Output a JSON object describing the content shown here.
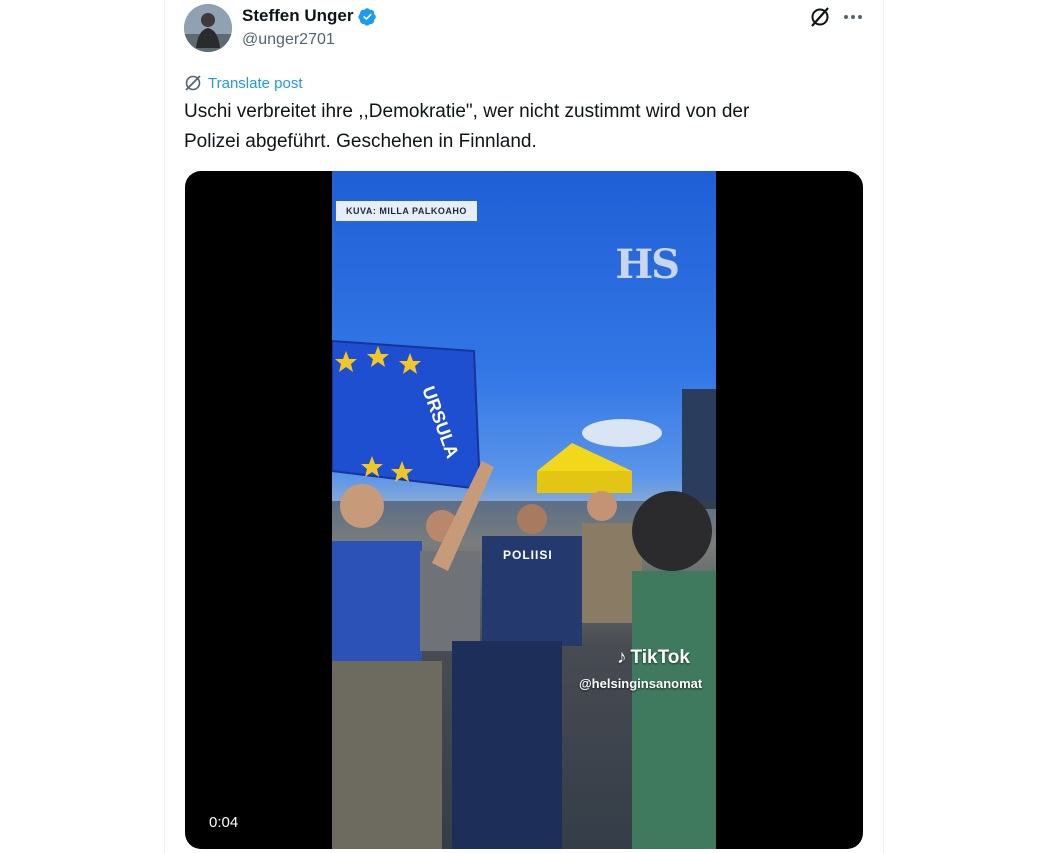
{
  "author": {
    "name": "Steffen Unger",
    "handle": "@unger2701",
    "verified": true
  },
  "actions": {
    "translate_label": "Translate post"
  },
  "post": {
    "text_line1": "Uschi verbreitet ihre ,,Demokratie\", wer nicht zustimmt wird von der",
    "text_line2": "Polizei abgeführt. Geschehen in Finnland."
  },
  "video": {
    "timestamp": "0:04",
    "overlay_credit": "KUVA: MILLA PALKOAHO",
    "overlay_logo": "HS",
    "tiktok_label": "TikTok",
    "tiktok_handle": "@helsinginsanomat",
    "banner_text": "URSULA",
    "vest_text": "POLIISI"
  },
  "colors": {
    "accent": "#1d9bf0",
    "text": "#0f1419",
    "secondary": "#536471"
  }
}
